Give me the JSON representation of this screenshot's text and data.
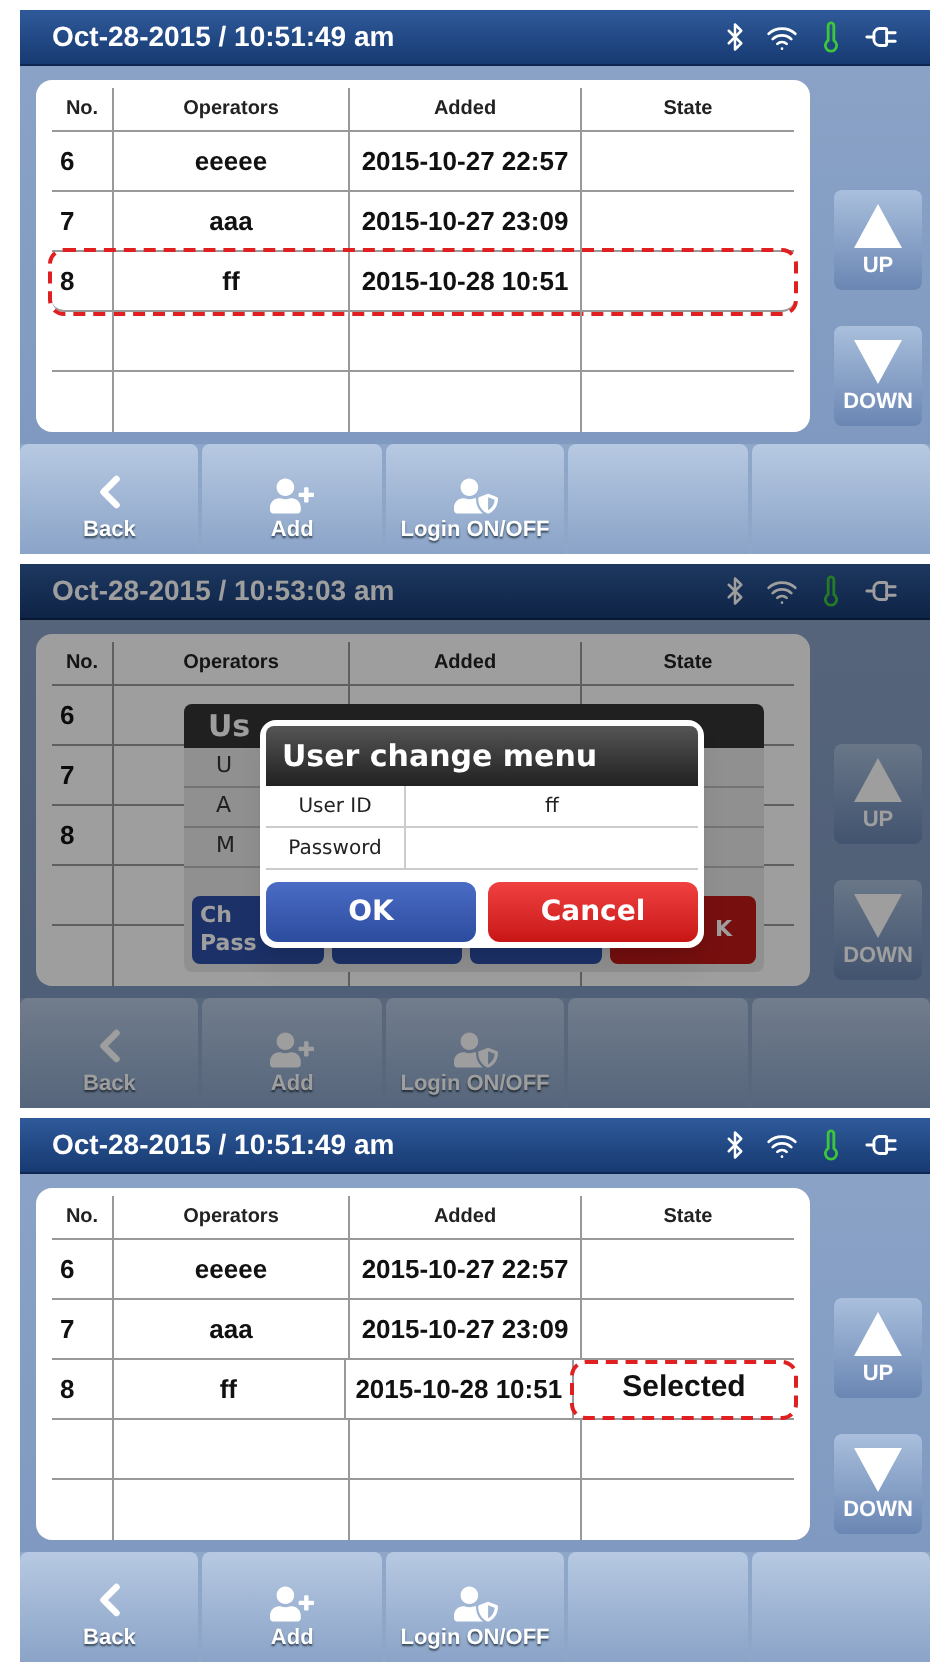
{
  "screens": [
    {
      "kind": "list",
      "dimmed": false,
      "status_bar": {
        "datetime": "Oct-28-2015 / 10:51:49 am"
      },
      "table": {
        "columns": [
          "No.",
          "Operators",
          "Added",
          "State"
        ],
        "rows": [
          {
            "kind": "data",
            "no": "6",
            "operator": "eeeee",
            "added": "2015-10-27 22:57",
            "outlined": false,
            "state_outlined": false
          },
          {
            "kind": "data",
            "no": "7",
            "operator": "aaa",
            "added": "2015-10-27 23:09",
            "outlined": false,
            "state_outlined": false
          },
          {
            "kind": "data",
            "no": "8",
            "operator": "ff",
            "added": "2015-10-28 10:51",
            "outlined": true,
            "state_outlined": false
          },
          {
            "kind": "empty"
          },
          {
            "kind": "empty"
          }
        ]
      },
      "scroll_buttons": [
        {
          "kind": "up",
          "label": "UP"
        },
        {
          "kind": "down",
          "label": "DOWN"
        }
      ],
      "toolbar": [
        {
          "kind": "back",
          "label": "Back"
        },
        {
          "kind": "add-user",
          "label": "Add"
        },
        {
          "kind": "user-shield",
          "label": "Login ON/OFF"
        },
        {
          "kind": "blank"
        },
        {
          "kind": "blank"
        }
      ]
    },
    {
      "kind": "dialog",
      "dimmed": true,
      "status_bar": {
        "datetime": "Oct-28-2015 / 10:53:03 am"
      },
      "table": {
        "columns": [
          "No.",
          "Operators",
          "Added",
          "State"
        ],
        "rows": [
          {
            "kind": "data",
            "no": "6",
            "outlined": false,
            "state_outlined": false
          },
          {
            "kind": "data",
            "no": "7",
            "outlined": false,
            "state_outlined": false
          },
          {
            "kind": "data",
            "no": "8",
            "outlined": false,
            "state_outlined": false
          },
          {
            "kind": "empty"
          },
          {
            "kind": "empty"
          }
        ]
      },
      "scroll_buttons": [
        {
          "kind": "up",
          "label": "UP"
        },
        {
          "kind": "down",
          "label": "DOWN"
        }
      ],
      "toolbar": [
        {
          "kind": "back",
          "label": "Back"
        },
        {
          "kind": "add-user",
          "label": "Add"
        },
        {
          "kind": "user-shield",
          "label": "Login ON/OFF"
        },
        {
          "kind": "blank"
        },
        {
          "kind": "blank"
        }
      ],
      "behind_dialog": {
        "title": "Us",
        "row_labels": [
          "U",
          "A",
          "M"
        ],
        "buttons": [
          {
            "kind": "blue",
            "lines": [
              "Ch",
              "Pass"
            ]
          },
          {
            "kind": "blue"
          },
          {
            "kind": "blue"
          },
          {
            "kind": "red",
            "lines": [
              "K"
            ]
          }
        ]
      },
      "dialog": {
        "title": "User change menu",
        "fields": [
          {
            "label": "User ID",
            "value": "ff"
          },
          {
            "label": "Password"
          }
        ],
        "buttons": [
          {
            "kind": "ok",
            "label": "OK"
          },
          {
            "kind": "cancel",
            "label": "Cancel"
          }
        ]
      }
    },
    {
      "kind": "list",
      "dimmed": false,
      "status_bar": {
        "datetime": "Oct-28-2015 / 10:51:49 am"
      },
      "table": {
        "columns": [
          "No.",
          "Operators",
          "Added",
          "State"
        ],
        "rows": [
          {
            "kind": "data",
            "no": "6",
            "operator": "eeeee",
            "added": "2015-10-27 22:57",
            "outlined": false,
            "state_outlined": false
          },
          {
            "kind": "data",
            "no": "7",
            "operator": "aaa",
            "added": "2015-10-27 23:09",
            "outlined": false,
            "state_outlined": false
          },
          {
            "kind": "data",
            "no": "8",
            "operator": "ff",
            "added": "2015-10-28 10:51",
            "state": "Selected",
            "outlined": false,
            "state_outlined": true
          },
          {
            "kind": "empty"
          },
          {
            "kind": "empty"
          }
        ]
      },
      "scroll_buttons": [
        {
          "kind": "up",
          "label": "UP"
        },
        {
          "kind": "down",
          "label": "DOWN"
        }
      ],
      "toolbar": [
        {
          "kind": "back",
          "label": "Back"
        },
        {
          "kind": "add-user",
          "label": "Add"
        },
        {
          "kind": "user-shield",
          "label": "Login ON/OFF"
        },
        {
          "kind": "blank"
        },
        {
          "kind": "blank"
        }
      ]
    }
  ]
}
